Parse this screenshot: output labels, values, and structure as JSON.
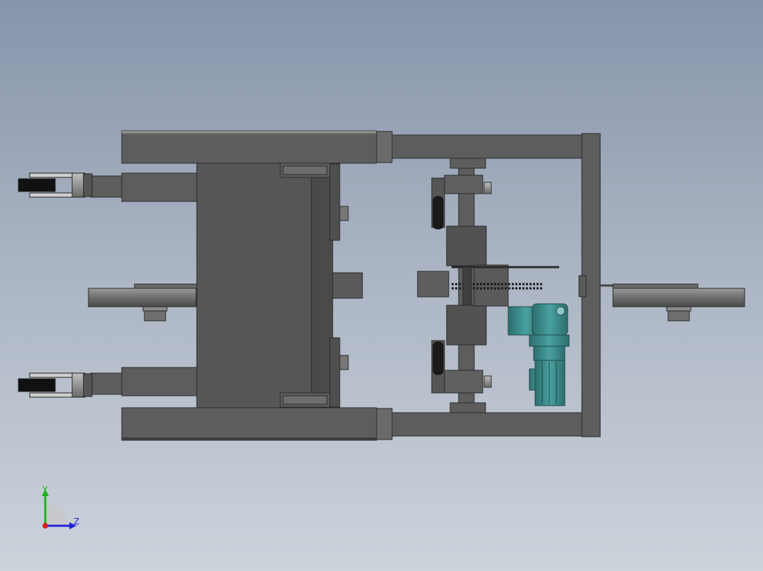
{
  "viewport": {
    "background_top": "#8794aa",
    "background_bottom": "#cdd3db"
  },
  "model": {
    "frame_color": "#5d5d5d",
    "edge_color": "#2a2a2a",
    "motor_color": "#3f8c8c"
  },
  "triad": {
    "y_label": "Y",
    "z_label": "Z",
    "y_color": "#1db31d",
    "z_color": "#2323d6",
    "x_color": "#d62020"
  }
}
